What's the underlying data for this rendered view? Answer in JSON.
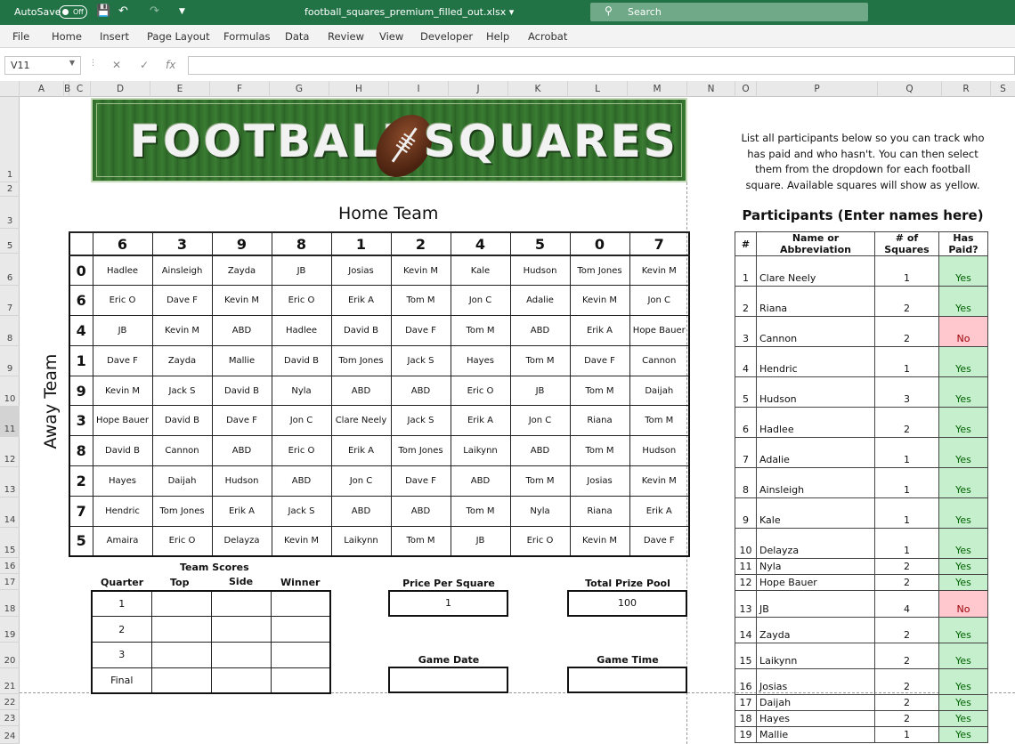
{
  "titlebar": {
    "autosave_label": "AutoSave",
    "autosave_state": "Off",
    "filename": "football_squares_premium_filled_out.xlsx",
    "search_placeholder": "Search"
  },
  "menu": [
    "File",
    "Home",
    "Insert",
    "Page Layout",
    "Formulas",
    "Data",
    "Review",
    "View",
    "Developer",
    "Help",
    "Acrobat"
  ],
  "formula_bar": {
    "name_box": "V11",
    "formula": ""
  },
  "columns": [
    "A",
    "B",
    "C",
    "D",
    "E",
    "F",
    "G",
    "H",
    "I",
    "J",
    "K",
    "L",
    "M",
    "N",
    "O",
    "P",
    "Q",
    "R",
    "S"
  ],
  "rows": [
    "1",
    "2",
    "3",
    "5",
    "6",
    "7",
    "8",
    "9",
    "10",
    "11",
    "12",
    "13",
    "14",
    "15",
    "16",
    "17",
    "18",
    "19",
    "20",
    "21",
    "22",
    "23",
    "24"
  ],
  "banner": {
    "word1": "FOOTBALL",
    "word2": "SQUARES"
  },
  "instructions": "List all participants below so you can track who has paid and who hasn't. You can then select them from the dropdown for each football square. Available squares will show as yellow.",
  "home_team_label": "Home Team",
  "away_team_label": "Away Team",
  "home_numbers": [
    "6",
    "3",
    "9",
    "8",
    "1",
    "2",
    "4",
    "5",
    "0",
    "7"
  ],
  "away_numbers": [
    "0",
    "6",
    "4",
    "1",
    "9",
    "3",
    "8",
    "2",
    "7",
    "5"
  ],
  "squares": [
    [
      "Hadlee",
      "Ainsleigh",
      "Zayda",
      "JB",
      "Josias",
      "Kevin M",
      "Kale",
      "Hudson",
      "Tom Jones",
      "Kevin M"
    ],
    [
      "Eric O",
      "Dave F",
      "Kevin M",
      "Eric O",
      "Erik A",
      "Tom M",
      "Jon C",
      "Adalie",
      "Kevin M",
      "Jon C"
    ],
    [
      "JB",
      "Kevin M",
      "ABD",
      "Hadlee",
      "David B",
      "Dave F",
      "Tom M",
      "ABD",
      "Erik A",
      "Hope Bauer"
    ],
    [
      "Dave F",
      "Zayda",
      "Mallie",
      "David B",
      "Tom Jones",
      "Jack S",
      "Hayes",
      "Tom M",
      "Dave F",
      "Cannon"
    ],
    [
      "Kevin M",
      "Jack S",
      "David B",
      "Nyla",
      "ABD",
      "ABD",
      "Eric O",
      "JB",
      "Tom M",
      "Daijah"
    ],
    [
      "Hope Bauer",
      "David B",
      "Dave F",
      "Jon C",
      "Clare Neely",
      "Jack S",
      "Erik A",
      "Jon C",
      "Riana",
      "Tom M"
    ],
    [
      "David B",
      "Cannon",
      "ABD",
      "Eric O",
      "Erik A",
      "Tom Jones",
      "Laikynn",
      "ABD",
      "Tom M",
      "Hudson"
    ],
    [
      "Hayes",
      "Daijah",
      "Hudson",
      "ABD",
      "Jon C",
      "Dave F",
      "ABD",
      "Tom M",
      "Josias",
      "Kevin M"
    ],
    [
      "Hendric",
      "Tom Jones",
      "Erik A",
      "Jack S",
      "ABD",
      "ABD",
      "Tom M",
      "Nyla",
      "Riana",
      "Erik A"
    ],
    [
      "Amaira",
      "Eric O",
      "Delayza",
      "Kevin M",
      "Laikynn",
      "Tom M",
      "JB",
      "Eric O",
      "Kevin M",
      "Dave F"
    ]
  ],
  "scores": {
    "title": "Team Scores",
    "headers": [
      "Quarter",
      "Top",
      "Side",
      "Winner"
    ],
    "rows": [
      "1",
      "2",
      "3",
      "Final"
    ]
  },
  "price_per_square": {
    "label": "Price Per Square",
    "value": "1"
  },
  "total_prize_pool": {
    "label": "Total Prize Pool",
    "value": "100"
  },
  "game_date": {
    "label": "Game Date",
    "value": ""
  },
  "game_time": {
    "label": "Game Time",
    "value": ""
  },
  "participants": {
    "title": "Participants (Enter names here)",
    "headers": [
      "#",
      "Name or Abbreviation",
      "# of Squares",
      "Has Paid?"
    ],
    "rows": [
      {
        "n": "1",
        "name": "Clare Neely",
        "count": "1",
        "paid": "Yes"
      },
      {
        "n": "2",
        "name": "Riana",
        "count": "2",
        "paid": "Yes"
      },
      {
        "n": "3",
        "name": "Cannon",
        "count": "2",
        "paid": "No"
      },
      {
        "n": "4",
        "name": "Hendric",
        "count": "1",
        "paid": "Yes"
      },
      {
        "n": "5",
        "name": "Hudson",
        "count": "3",
        "paid": "Yes"
      },
      {
        "n": "6",
        "name": "Hadlee",
        "count": "2",
        "paid": "Yes"
      },
      {
        "n": "7",
        "name": "Adalie",
        "count": "1",
        "paid": "Yes"
      },
      {
        "n": "8",
        "name": "Ainsleigh",
        "count": "1",
        "paid": "Yes"
      },
      {
        "n": "9",
        "name": "Kale",
        "count": "1",
        "paid": "Yes"
      },
      {
        "n": "10",
        "name": "Delayza",
        "count": "1",
        "paid": "Yes"
      },
      {
        "n": "11",
        "name": "Nyla",
        "count": "2",
        "paid": "Yes"
      },
      {
        "n": "12",
        "name": "Hope Bauer",
        "count": "2",
        "paid": "Yes"
      },
      {
        "n": "13",
        "name": "JB",
        "count": "4",
        "paid": "No"
      },
      {
        "n": "14",
        "name": "Zayda",
        "count": "2",
        "paid": "Yes"
      },
      {
        "n": "15",
        "name": "Laikynn",
        "count": "2",
        "paid": "Yes"
      },
      {
        "n": "16",
        "name": "Josias",
        "count": "2",
        "paid": "Yes"
      },
      {
        "n": "17",
        "name": "Daijah",
        "count": "2",
        "paid": "Yes"
      },
      {
        "n": "18",
        "name": "Hayes",
        "count": "2",
        "paid": "Yes"
      },
      {
        "n": "19",
        "name": "Mallie",
        "count": "1",
        "paid": "Yes"
      }
    ]
  },
  "colors": {
    "excel_green": "#217346",
    "paid_yes_bg": "#c6efce",
    "paid_no_bg": "#ffc7ce"
  }
}
